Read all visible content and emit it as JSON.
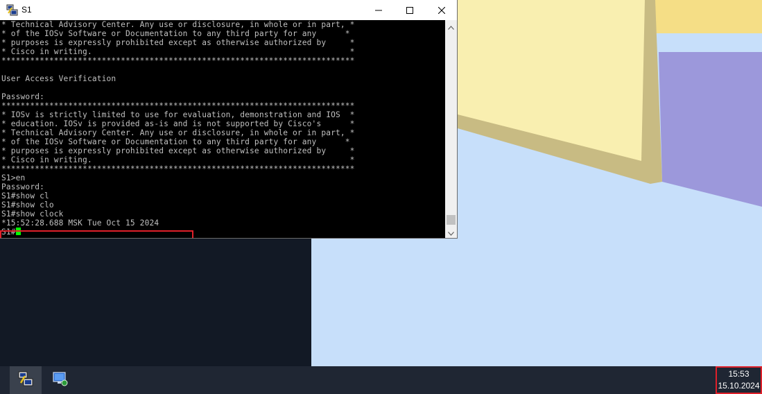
{
  "window": {
    "title": "S1",
    "app_icon": "putty-icon",
    "controls": {
      "minimize": "minimize-icon",
      "maximize": "maximize-icon",
      "close": "close-icon"
    }
  },
  "terminal": {
    "lines": [
      "* Technical Advisory Center. Any use or disclosure, in whole or in part, *",
      "* of the IOSv Software or Documentation to any third party for any      *",
      "* purposes is expressly prohibited except as otherwise authorized by     *",
      "* Cisco in writing.                                                      *",
      "**************************************************************************",
      "",
      "User Access Verification",
      "",
      "Password:",
      "**************************************************************************",
      "* IOSv is strictly limited to use for evaluation, demonstration and IOS  *",
      "* education. IOSv is provided as-is and is not supported by Cisco's      *",
      "* Technical Advisory Center. Any use or disclosure, in whole or in part, *",
      "* of the IOSv Software or Documentation to any third party for any      *",
      "* purposes is expressly prohibited except as otherwise authorized by     *",
      "* Cisco in writing.                                                      *",
      "**************************************************************************",
      "S1>en",
      "Password:",
      "S1#show cl",
      "S1#show clo",
      "S1#show clock",
      "*15:52:28.688 MSK Tue Oct 15 2024"
    ],
    "prompt": "S1#",
    "cursor_color": "#00ff00"
  },
  "taskbar": {
    "items": [
      {
        "name": "putty-taskbar-icon",
        "active": true
      },
      {
        "name": "network-taskbar-icon",
        "active": false
      }
    ],
    "clock": {
      "time": "15:53",
      "date": "15.10.2024"
    }
  },
  "colors": {
    "highlight": "#e0202a",
    "terminal_bg": "#000000",
    "terminal_fg": "#c0c0c0",
    "taskbar_bg": "#1f2633",
    "desktop_dark": "#121925",
    "desktop_light": "#c7dffa"
  }
}
